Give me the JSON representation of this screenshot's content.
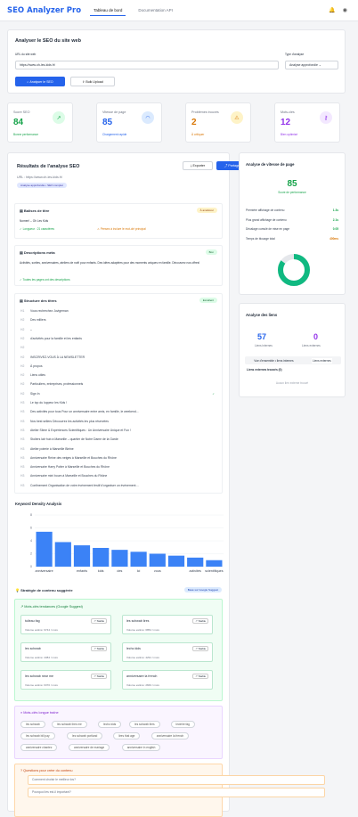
{
  "app": {
    "title": "SEO Analyzer Pro",
    "tabs": [
      "Tableau de bord",
      "Documentation API"
    ]
  },
  "form": {
    "title": "Analyser le SEO du site web",
    "url_label": "URL du site web",
    "url_value": "https://www.oh-les-kids.fr/",
    "type_label": "Type d'analyse",
    "type_value": "Analyse approfondie",
    "analyze_btn": "Analyser le SEO",
    "bulk_btn": "Bulk Upload"
  },
  "stats": [
    {
      "label": "Score SEO",
      "value": "84",
      "note": "Bonne performance",
      "color": "#16a34a",
      "icon": "trend-icon",
      "bg": "#dcfce7"
    },
    {
      "label": "Vitesse de page",
      "value": "85",
      "note": "Chargement rapide",
      "color": "#2563eb",
      "icon": "gauge-icon",
      "bg": "#dbeafe"
    },
    {
      "label": "Problèmes trouvés",
      "value": "2",
      "note": "À critiquer",
      "color": "#d97706",
      "icon": "warning-icon",
      "bg": "#fef3c7"
    },
    {
      "label": "Mots-clés",
      "value": "12",
      "note": "Bien optimisé",
      "color": "#9333ea",
      "icon": "key-icon",
      "bg": "#f3e8ff"
    }
  ],
  "results": {
    "title": "Résultats de l'analyse SEO",
    "url_line": "URL : https://www.oh-les-kids.fr/",
    "badge": "Analyse approfondie • SEO complet",
    "export": "Exporter",
    "share": "Partager",
    "title_tag": {
      "title": "Balises de titre",
      "badge": "À améliorer",
      "value": "Nomen! – Oh Les Kids",
      "length": "Longueur : 21 caractères",
      "warn": "Pensez à inclure le mot-clé principal"
    },
    "meta": {
      "title": "Descriptions méta",
      "badge": "Bon",
      "text": "Activités, sorties, anniversaires, ateliers de noël pour enfants. Des idées adaptées pour des moments uniques en famille. Découvrez nos offres!",
      "ok": "Toutes les pages ont des descriptions"
    },
    "headings": {
      "title": "Structure des titres",
      "badge": "Excellent",
      "rows": [
        [
          "H1",
          "Vous recherchez Juvigeman"
        ],
        [
          "H2",
          "Des milliers"
        ],
        [
          "H2",
          "–"
        ],
        [
          "H2",
          "d'activités pour la famille et les enfants"
        ],
        [
          "H2",
          ""
        ],
        [
          "H2",
          "INSCRIVEZ-VOUS À LA NEWSLETTER"
        ],
        [
          "H2",
          "À propos"
        ],
        [
          "H2",
          "Liens utiles"
        ],
        [
          "H2",
          "Particuliers, entreprises, professionnels"
        ],
        [
          "H2",
          "Sign In"
        ],
        [
          "H3",
          "Le top du loppeur les Kids !"
        ],
        [
          "H3",
          "Des activités pour tous Pour un anniversaire entre amis, en famille, le weekend..."
        ],
        [
          "H3",
          "Nos best sellers Découvrez les activités les plus réservées"
        ],
        [
          "H3",
          "Atelier Slime & Expériences Scientifiques : Un Anniversaire Unique et Fun !"
        ],
        [
          "H3",
          "Stoliers lab·hub à Marseille – quartier de Notre Dame de la Garde"
        ],
        [
          "H3",
          "Atelier poterie à Marseille Bleine"
        ],
        [
          "H3",
          "Anniversaire Reine des neiges à Marseille et Bouches du Rhône"
        ],
        [
          "H3",
          "Anniversaire Harry Potter à Marseille et Bouches du Rhône"
        ],
        [
          "H3",
          "Anniversaire mini boum à Marseille et Bouches du Rhône"
        ],
        [
          "H3",
          "Confinement Organisation de votre événement festif d'organiser un événement ..."
        ]
      ]
    }
  },
  "keyword_density": {
    "title": "Keyword Density Analysis"
  },
  "chart_data": {
    "type": "bar",
    "categories": [
      "anniversaire",
      "",
      "enfants",
      "kids",
      "des",
      "lci",
      "vous",
      "",
      "activités",
      "scientifiques"
    ],
    "values": [
      5.4,
      3.8,
      3.3,
      2.9,
      2.6,
      2.3,
      2.0,
      1.7,
      1.4,
      1.0
    ],
    "ylim": [
      0,
      8
    ],
    "yticks": [
      "0",
      "2",
      "4",
      "6",
      "8"
    ]
  },
  "strategy": {
    "title": "Stratégie de contenu suggérée",
    "badge": "Basé sur Google Suggest",
    "trends_title": "Mots-clés tendances (Google Suggest)",
    "keywords": [
      {
        "t": "tuileau fag",
        "s": "Stable",
        "v": "Volume estimé: 9744 / mois"
      },
      {
        "t": "les schwab lires",
        "s": "Stable",
        "v": "Volume estimé: 6854 / mois"
      },
      {
        "t": "les schwab",
        "s": "Stable",
        "v": "Volume estimé: 4384 / mois"
      },
      {
        "t": "lecho kids",
        "s": "Stable",
        "v": "Volume estimé: 4291 / mois"
      },
      {
        "t": "les schwab near me",
        "s": "Stable",
        "v": "Volume estimé: 6370 / mois"
      },
      {
        "t": "anniversaire la french",
        "s": "Stable",
        "v": "Volume estimé: 2849 / mois"
      }
    ],
    "longtail_title": "Mots-clés longue traîne",
    "longtail": [
      "les schwab",
      "les schwab lires me",
      "lecho kids",
      "les schwab lires",
      "lecleire fag",
      "les schwab bill pay",
      "les schwab portland",
      "lires that age",
      "anniversaire la french",
      "anniversaire chantez",
      "anniversaire de mariage",
      "anniversaire in english"
    ],
    "questions_title": "Questions pour créer du contenu",
    "questions": [
      "Comment choisir le meilleur los?",
      "Pourquoi les est-il important?"
    ]
  },
  "speed": {
    "title": "Analyse de vitesse de page",
    "score": "85",
    "score_label": "Score de performance",
    "metrics": [
      [
        "Première affichage de contenu",
        "1.3s",
        "#16a34a"
      ],
      [
        "Plus grand affichage de contenu",
        "2.1s",
        "#16a34a"
      ],
      [
        "Décalage cumulé de mise en page",
        "0.05",
        "#16a34a"
      ],
      [
        "Temps de blocage total",
        "400ms",
        "#d97706"
      ]
    ],
    "percent": 85
  },
  "links": {
    "title": "Analyse des liens",
    "internal": "57",
    "internal_label": "Liens internes",
    "external": "0",
    "external_label": "Liens externes",
    "tab_all": "Vue d'ensemble • liens internes",
    "tab_ext": "Liens externes",
    "ext_found": "Liens externes trouvés (0)",
    "none": "Aucun lien externe trouvé"
  }
}
